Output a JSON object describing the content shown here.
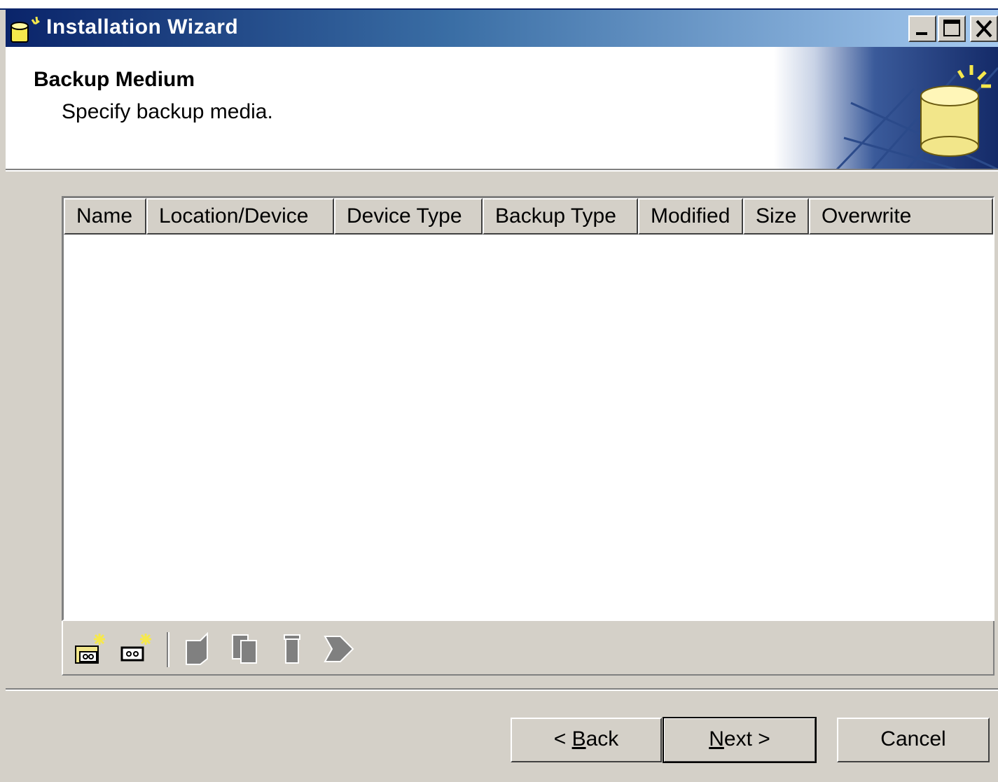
{
  "window": {
    "title": "Installation Wizard",
    "title_icon": "database-wizard-icon",
    "controls": [
      "minimize-icon",
      "maximize-icon",
      "close-icon"
    ],
    "title_gradient": [
      "#0a246a",
      "#a6caf0"
    ]
  },
  "header": {
    "title": "Backup Medium",
    "subtitle": "Specify backup media.",
    "art_icon": "database-cylinder-icon"
  },
  "list": {
    "columns": [
      "Name",
      "Location/Device",
      "Device Type",
      "Backup Type",
      "Modified",
      "Size",
      "Overwrite"
    ],
    "rows": []
  },
  "toolbar": {
    "items": [
      {
        "name": "new-folder-media-icon",
        "enabled": true
      },
      {
        "name": "new-tape-media-icon",
        "enabled": true
      },
      {
        "name": "edit-icon",
        "enabled": false
      },
      {
        "name": "copy-icon",
        "enabled": false
      },
      {
        "name": "delete-icon",
        "enabled": false
      },
      {
        "name": "properties-icon",
        "enabled": false
      }
    ]
  },
  "buttons": {
    "back": {
      "prefix": "< ",
      "mnemonic": "B",
      "rest": "ack"
    },
    "next": {
      "mnemonic": "N",
      "rest": "ext >"
    },
    "cancel": "Cancel"
  }
}
